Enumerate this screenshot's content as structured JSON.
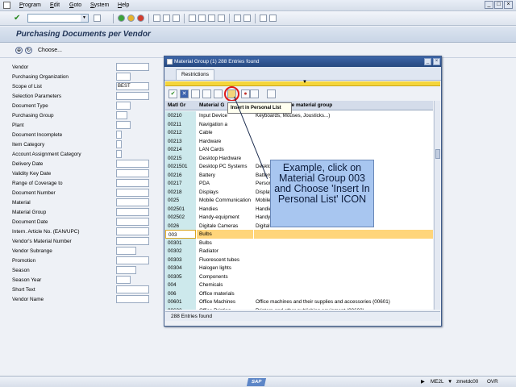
{
  "menu": [
    "Program",
    "Edit",
    "Goto",
    "System",
    "Help"
  ],
  "page_title": "Purchasing Documents per Vendor",
  "appbar": {
    "choose_label": "Choose..."
  },
  "form_fields": [
    {
      "label": "Vendor",
      "value": ""
    },
    {
      "label": "Purchasing Organization",
      "value": ""
    },
    {
      "label": "Scope of List",
      "value": "BEST"
    },
    {
      "label": "Selection Parameters",
      "value": ""
    },
    {
      "label": "Document Type",
      "value": ""
    },
    {
      "label": "Purchasing Group",
      "value": ""
    },
    {
      "label": "Plant",
      "value": ""
    },
    {
      "label": "Document Incomplete",
      "value": ""
    },
    {
      "label": "Item Category",
      "value": ""
    },
    {
      "label": "Account Assignment Category",
      "value": ""
    },
    {
      "label": "Delivery Date",
      "value": ""
    },
    {
      "label": "Validity Key Date",
      "value": ""
    },
    {
      "label": "Range of Coverage to",
      "value": ""
    },
    {
      "label": "Document Number",
      "value": ""
    },
    {
      "label": "Material",
      "value": ""
    },
    {
      "label": "Material Group",
      "value": ""
    },
    {
      "label": "Document Date",
      "value": ""
    },
    {
      "label": "Intern. Article No. (EAN/UPC)",
      "value": ""
    },
    {
      "label": "Vendor's Material Number",
      "value": ""
    },
    {
      "label": "Vendor Subrange",
      "value": ""
    },
    {
      "label": "Promotion",
      "value": ""
    },
    {
      "label": "Season",
      "value": ""
    },
    {
      "label": "Season Year",
      "value": ""
    },
    {
      "label": "Short Text",
      "value": ""
    },
    {
      "label": "Vendor Name",
      "value": ""
    }
  ],
  "popup": {
    "title": "Material Group (1)  288 Entries found",
    "tab_label": "Restrictions",
    "tooltip": "Insert in Personal List",
    "columns": [
      "Matl Gr",
      "Material G",
      "for the material group"
    ],
    "rows": [
      {
        "code": "00210",
        "name": "Input Device",
        "desc": "Keyboards, Mouses, Jousticks...)"
      },
      {
        "code": "00211",
        "name": "Navigation a",
        "desc": ""
      },
      {
        "code": "00212",
        "name": "Cable",
        "desc": ""
      },
      {
        "code": "00213",
        "name": "Hardware",
        "desc": ""
      },
      {
        "code": "00214",
        "name": "LAN Cards",
        "desc": ""
      },
      {
        "code": "00215",
        "name": "Desktop Hardware",
        "desc": ""
      },
      {
        "code": "0021501",
        "name": "Desktop PC Systems",
        "desc": "Desktop PC Systems"
      },
      {
        "code": "00216",
        "name": "Battery",
        "desc": "Battery"
      },
      {
        "code": "00217",
        "name": "PDA",
        "desc": "Person"
      },
      {
        "code": "00218",
        "name": "Displays",
        "desc": "Display"
      },
      {
        "code": "0025",
        "name": "Mobile Communication",
        "desc": "Mobile"
      },
      {
        "code": "002501",
        "name": "Handies",
        "desc": "Handie"
      },
      {
        "code": "002502",
        "name": "Handy-equipment",
        "desc": "Handy-"
      },
      {
        "code": "0026",
        "name": "Digitale Cameras",
        "desc": "Digital"
      },
      {
        "code": "003",
        "name": "Bulbs",
        "desc": ""
      },
      {
        "code": "00301",
        "name": "Bulbs",
        "desc": ""
      },
      {
        "code": "00302",
        "name": "Radiator",
        "desc": ""
      },
      {
        "code": "00303",
        "name": "Fluorescent tubes",
        "desc": ""
      },
      {
        "code": "00304",
        "name": "Halogen lights",
        "desc": ""
      },
      {
        "code": "00305",
        "name": "Components",
        "desc": ""
      },
      {
        "code": "004",
        "name": "Chemicals",
        "desc": ""
      },
      {
        "code": "006",
        "name": "Office materials",
        "desc": ""
      },
      {
        "code": "00601",
        "name": "Office Machines",
        "desc": "Office machines and their supplies and accessories (00601)"
      },
      {
        "code": "00602",
        "name": "Office Printing",
        "desc": "Printers and other publishing equipment (00602)"
      }
    ],
    "status": "288 Entries found"
  },
  "callout": "Example, click on Material Group 003 and Choose 'Insert In Personal List' ICON",
  "statusbar": {
    "tcode": "ME2L",
    "server": "zmetdc00",
    "mode": "OVR"
  }
}
